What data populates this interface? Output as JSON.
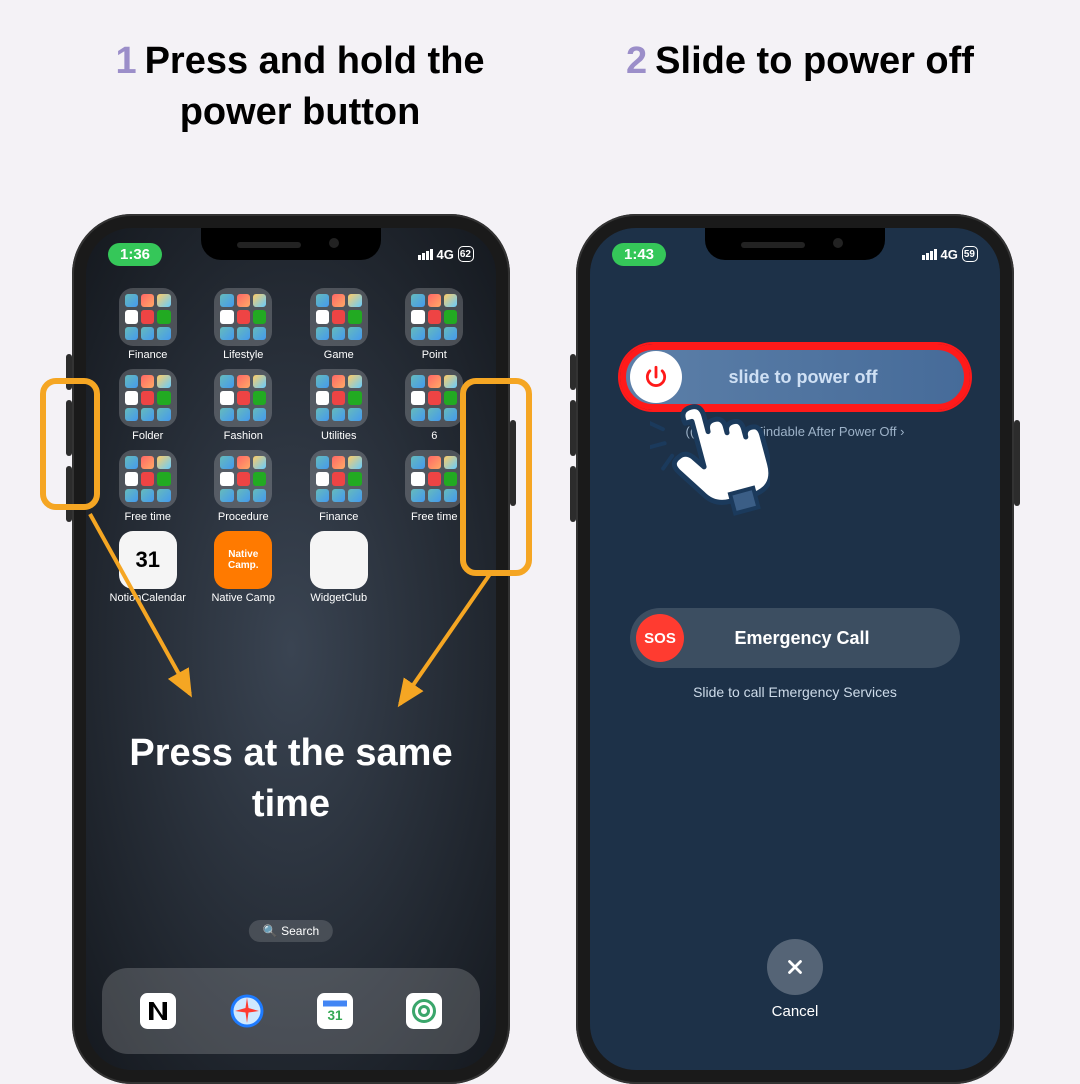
{
  "steps": {
    "1": {
      "num": "1",
      "title": "Press and hold the power button"
    },
    "2": {
      "num": "2",
      "title": "Slide to power off"
    }
  },
  "screen1": {
    "time": "1:36",
    "net": "4G",
    "batt": "62",
    "folders": [
      {
        "label": "Finance"
      },
      {
        "label": "Lifestyle"
      },
      {
        "label": "Game"
      },
      {
        "label": "Point"
      },
      {
        "label": "Folder"
      },
      {
        "label": "Fashion"
      },
      {
        "label": "Utilities"
      },
      {
        "label": "6"
      },
      {
        "label": "Free time"
      },
      {
        "label": "Procedure"
      },
      {
        "label": "Finance"
      },
      {
        "label": "Free time"
      }
    ],
    "apps": [
      {
        "label": "NotionCalendar",
        "bg": "#f5f5f5",
        "text": "31"
      },
      {
        "label": "Native Camp",
        "bg": "#ff7a00",
        "text": "Native Camp."
      },
      {
        "label": "WidgetClub",
        "bg": "#f5f5f5",
        "text": ""
      }
    ],
    "overlay": "Press at the same time",
    "search": "Search",
    "dock": [
      {
        "name": "notion",
        "bg": "#fff"
      },
      {
        "name": "safari",
        "bg": "linear-gradient(#6ac0ff,#1e7bff)"
      },
      {
        "name": "calendar",
        "bg": "#fff"
      },
      {
        "name": "chatgpt",
        "bg": "#fff"
      }
    ]
  },
  "screen2": {
    "time": "1:43",
    "net": "4G",
    "batt": "59",
    "slide_label": "slide to power off",
    "findable": "iPhone Findable After Power Off",
    "sos_knob": "SOS",
    "sos_label": "Emergency Call",
    "sos_sub": "Slide to call Emergency Services",
    "cancel": "Cancel"
  }
}
